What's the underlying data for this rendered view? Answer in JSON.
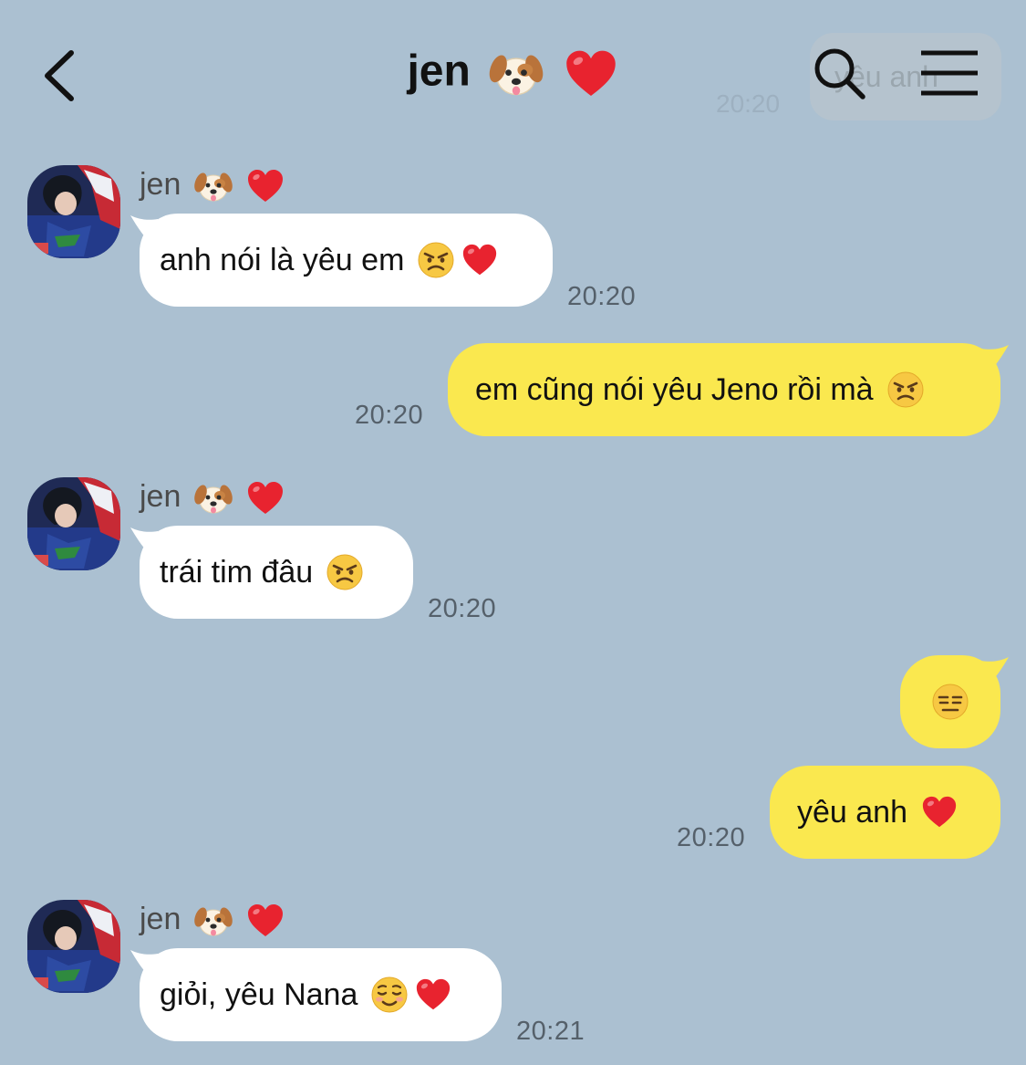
{
  "header": {
    "title": "jen",
    "title_emojis": [
      "dog-face-emoji",
      "red-heart-emoji"
    ],
    "ghost_preview_text": "yêu anh",
    "ghost_preview_time": "20:20"
  },
  "messages": [
    {
      "direction": "incoming",
      "sender": "jen",
      "sender_emojis": [
        "dog-face-emoji",
        "red-heart-emoji"
      ],
      "text": "anh nói là yêu em",
      "emojis": [
        "angry-face-emoji",
        "red-heart-emoji"
      ],
      "time": "20:20"
    },
    {
      "direction": "outgoing",
      "text": "em cũng nói yêu Jeno rồi mà",
      "emojis": [
        "angry-face-emoji"
      ],
      "time": "20:20"
    },
    {
      "direction": "incoming",
      "sender": "jen",
      "sender_emojis": [
        "dog-face-emoji",
        "red-heart-emoji"
      ],
      "text": "trái tim đâu",
      "emojis": [
        "angry-face-emoji"
      ],
      "time": "20:20"
    },
    {
      "direction": "outgoing",
      "text": "",
      "emojis": [
        "expressionless-face-emoji"
      ],
      "time": ""
    },
    {
      "direction": "outgoing",
      "text": "yêu anh",
      "emojis": [
        "red-heart-emoji"
      ],
      "time": "20:20"
    },
    {
      "direction": "incoming",
      "sender": "jen",
      "sender_emojis": [
        "dog-face-emoji",
        "red-heart-emoji"
      ],
      "text": "giỏi, yêu Nana",
      "emojis": [
        "smiling-face-emoji",
        "red-heart-emoji"
      ],
      "time": "20:21"
    }
  ],
  "colors": {
    "background": "#abc0d1",
    "incoming_bubble": "#ffffff",
    "outgoing_bubble": "#fae84f",
    "time_text": "#55606a",
    "sender_text": "#4a4a4a"
  }
}
